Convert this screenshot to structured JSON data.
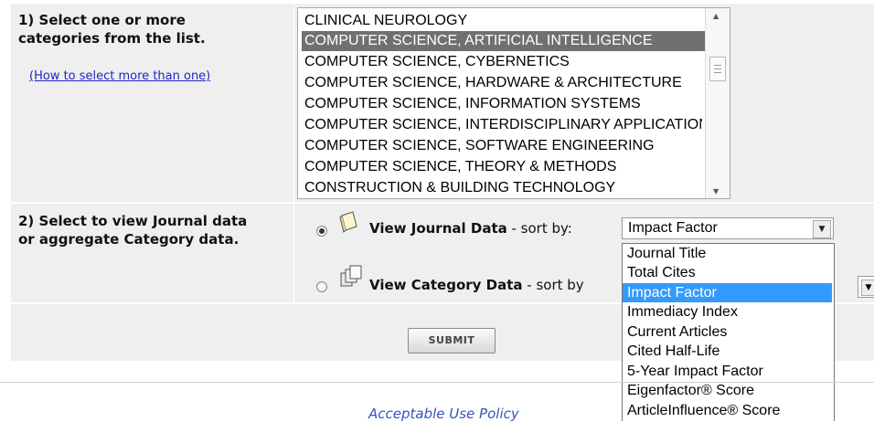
{
  "step1": {
    "label": "1) Select one or more categories from the list.",
    "label_line1": "1) Select one or more",
    "label_line2": "categories from the list.",
    "howto_link": "(How to select more than one)"
  },
  "categories": {
    "items": [
      "CLINICAL NEUROLOGY",
      "COMPUTER SCIENCE, ARTIFICIAL INTELLIGENCE",
      "COMPUTER SCIENCE, CYBERNETICS",
      "COMPUTER SCIENCE, HARDWARE & ARCHITECTURE",
      "COMPUTER SCIENCE, INFORMATION SYSTEMS",
      "COMPUTER SCIENCE, INTERDISCIPLINARY APPLICATIONS",
      "COMPUTER SCIENCE, SOFTWARE ENGINEERING",
      "COMPUTER SCIENCE, THEORY & METHODS",
      "CONSTRUCTION & BUILDING TECHNOLOGY"
    ],
    "selected": "COMPUTER SCIENCE, ARTIFICIAL INTELLIGENCE"
  },
  "step2": {
    "label_line1": "2) Select to view Journal data",
    "label_line2": "or aggregate Category data.",
    "journal_option": {
      "label": "View Journal Data",
      "suffix": " - sort by:",
      "checked": true
    },
    "category_option": {
      "label": "View Category Data",
      "suffix": " - sort by",
      "checked": false
    }
  },
  "sort_select": {
    "selected": "Impact Factor",
    "options": [
      "Journal Title",
      "Total Cites",
      "Impact Factor",
      "Immediacy Index",
      "Current Articles",
      "Cited Half-Life",
      "5-Year Impact Factor",
      "Eigenfactor® Score",
      "ArticleInfluence® Score"
    ]
  },
  "submit_label": "SUBMIT",
  "footer": {
    "policy_link": "Acceptable Use Policy"
  },
  "colors": {
    "cell_bg": "#efefef",
    "selected_item_bg": "#707070",
    "highlight_option": "#3399ff",
    "link": "#2222cc"
  }
}
